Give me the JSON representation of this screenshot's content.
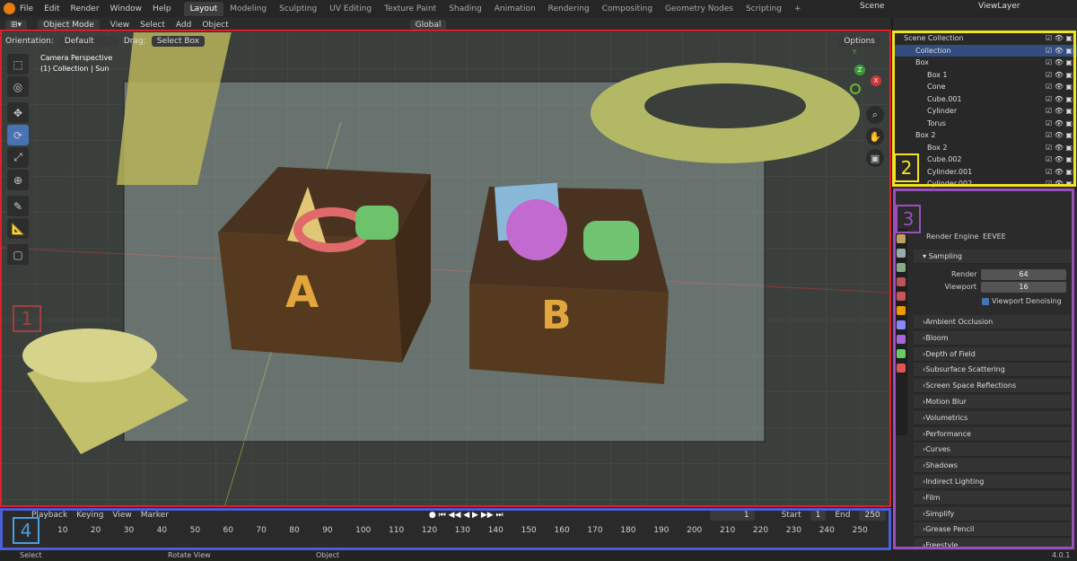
{
  "topbar": {
    "menu": [
      "File",
      "Edit",
      "Render",
      "Window",
      "Help"
    ],
    "tabs": [
      "Layout",
      "Modeling",
      "Sculpting",
      "UV Editing",
      "Texture Paint",
      "Shading",
      "Animation",
      "Rendering",
      "Compositing",
      "Geometry Nodes",
      "Scripting",
      "+"
    ],
    "active_tab": "Layout",
    "scene": "Scene",
    "view_layer": "ViewLayer"
  },
  "viewport": {
    "mode": "Object Mode",
    "menus": [
      "View",
      "Select",
      "Add",
      "Object"
    ],
    "transform": "Global",
    "orientation_label": "Orientation:",
    "orientation_value": "Default",
    "drag_label": "Drag:",
    "drag_value": "Select Box",
    "options": "Options",
    "overlay_line1": "Camera Perspective",
    "overlay_line2": "(1) Collection | Sun",
    "box_a": "A",
    "box_b": "B",
    "axis_x": "X",
    "axis_y": "Y",
    "axis_z": "Z"
  },
  "outliner": {
    "rows": [
      {
        "name": "Scene Collection",
        "indent": 0
      },
      {
        "name": "Collection",
        "indent": 1,
        "selected": true
      },
      {
        "name": "Box",
        "indent": 1
      },
      {
        "name": "Box 1",
        "indent": 2
      },
      {
        "name": "Cone",
        "indent": 2
      },
      {
        "name": "Cube.001",
        "indent": 2
      },
      {
        "name": "Cylinder",
        "indent": 2
      },
      {
        "name": "Torus",
        "indent": 2
      },
      {
        "name": "Box 2",
        "indent": 1
      },
      {
        "name": "Box 2",
        "indent": 2
      },
      {
        "name": "Cube.002",
        "indent": 2
      },
      {
        "name": "Cylinder.001",
        "indent": 2
      },
      {
        "name": "Cylinder.002",
        "indent": 2
      }
    ]
  },
  "properties": {
    "render_engine_label": "Render Engine",
    "render_engine_value": "EEVEE",
    "sampling": "Sampling",
    "render_label": "Render",
    "render_value": "64",
    "viewport_label": "Viewport",
    "viewport_value": "16",
    "denoise": "Viewport Denoising",
    "panels": [
      "Ambient Occlusion",
      "Bloom",
      "Depth of Field",
      "Subsurface Scattering",
      "Screen Space Reflections",
      "Motion Blur",
      "Volumetrics",
      "Performance",
      "Curves",
      "Shadows",
      "Indirect Lighting",
      "Film",
      "Simplify",
      "Grease Pencil",
      "Freestyle"
    ]
  },
  "timeline": {
    "menus": [
      "Playback",
      "Keying",
      "View",
      "Marker"
    ],
    "current_frame": "1",
    "start_label": "Start",
    "start": "1",
    "end_label": "End",
    "end": "250",
    "ticks": [
      "10",
      "20",
      "30",
      "40",
      "50",
      "60",
      "70",
      "80",
      "90",
      "100",
      "110",
      "120",
      "130",
      "140",
      "150",
      "160",
      "170",
      "180",
      "190",
      "200",
      "210",
      "220",
      "230",
      "240",
      "250"
    ]
  },
  "status": {
    "select": "Select",
    "rotate": "Rotate View",
    "object": "Object",
    "version": "4.0.1"
  },
  "labels": {
    "one": "1",
    "two": "2",
    "three": "3",
    "four": "4"
  },
  "colors": {
    "red": "#e0202a",
    "yellow": "#f2e320",
    "purple": "#9b4fbf",
    "blue": "#4a5fd9",
    "selection": "#4772b3"
  }
}
